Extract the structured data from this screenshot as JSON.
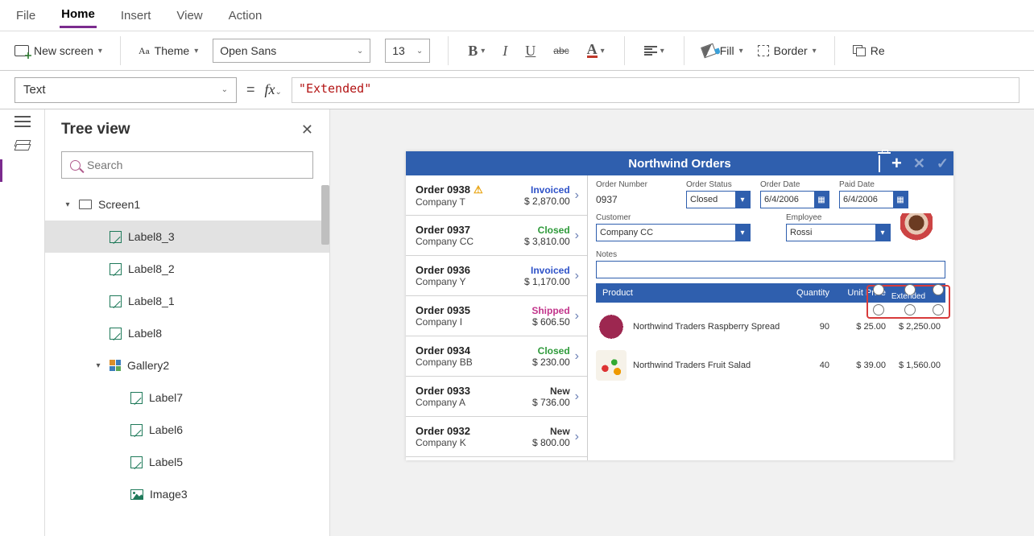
{
  "menu": {
    "items": [
      "File",
      "Home",
      "Insert",
      "View",
      "Action"
    ],
    "active": "Home"
  },
  "ribbon": {
    "new_screen": "New screen",
    "theme": "Theme",
    "font": "Open Sans",
    "font_size": "13",
    "fill": "Fill",
    "border": "Border",
    "reorder_abbr": "Re"
  },
  "formula": {
    "property": "Text",
    "value": "Extended"
  },
  "tree": {
    "title": "Tree view",
    "search_placeholder": "Search",
    "nodes": [
      {
        "d": 1,
        "kind": "screen",
        "label": "Screen1",
        "exp": true
      },
      {
        "d": 2,
        "kind": "label",
        "label": "Label8_3",
        "sel": true
      },
      {
        "d": 2,
        "kind": "label",
        "label": "Label8_2"
      },
      {
        "d": 2,
        "kind": "label",
        "label": "Label8_1"
      },
      {
        "d": 2,
        "kind": "label",
        "label": "Label8"
      },
      {
        "d": 2,
        "kind": "gallery",
        "label": "Gallery2",
        "exp": true
      },
      {
        "d": 3,
        "kind": "label",
        "label": "Label7"
      },
      {
        "d": 3,
        "kind": "label",
        "label": "Label6"
      },
      {
        "d": 3,
        "kind": "label",
        "label": "Label5"
      },
      {
        "d": 3,
        "kind": "image",
        "label": "Image3"
      }
    ]
  },
  "app": {
    "title": "Northwind Orders",
    "orders": [
      {
        "id": "Order 0938",
        "co": "Company T",
        "status": "Invoiced",
        "amt": "$ 2,870.00",
        "warn": true
      },
      {
        "id": "Order 0937",
        "co": "Company CC",
        "status": "Closed",
        "amt": "$ 3,810.00"
      },
      {
        "id": "Order 0936",
        "co": "Company Y",
        "status": "Invoiced",
        "amt": "$ 1,170.00"
      },
      {
        "id": "Order 0935",
        "co": "Company I",
        "status": "Shipped",
        "amt": "$ 606.50"
      },
      {
        "id": "Order 0934",
        "co": "Company BB",
        "status": "Closed",
        "amt": "$ 230.00"
      },
      {
        "id": "Order 0933",
        "co": "Company A",
        "status": "New",
        "amt": "$ 736.00"
      },
      {
        "id": "Order 0932",
        "co": "Company K",
        "status": "New",
        "amt": "$ 800.00"
      }
    ],
    "detail": {
      "order_number_label": "Order Number",
      "order_number": "0937",
      "order_status_label": "Order Status",
      "order_status": "Closed",
      "order_date_label": "Order Date",
      "order_date": "6/4/2006",
      "paid_date_label": "Paid Date",
      "paid_date": "6/4/2006",
      "customer_label": "Customer",
      "customer": "Company CC",
      "employee_label": "Employee",
      "employee": "Rossi",
      "notes_label": "Notes"
    },
    "items_header": {
      "product": "Product",
      "quantity": "Quantity",
      "unit_price": "Unit Price",
      "extended": "Extended"
    },
    "items": [
      {
        "thumb": "rasp",
        "name": "Northwind Traders Raspberry Spread",
        "qty": "90",
        "unit": "$ 25.00",
        "ext": "$ 2,250.00"
      },
      {
        "thumb": "fruit",
        "name": "Northwind Traders Fruit Salad",
        "qty": "40",
        "unit": "$ 39.00",
        "ext": "$ 1,560.00"
      }
    ]
  }
}
